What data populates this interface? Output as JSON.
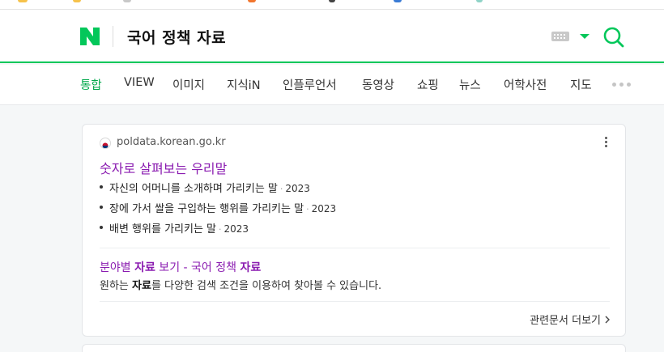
{
  "header": {
    "logo": "N",
    "query": "국어 정책 자료",
    "icons": [
      "keyboard-icon",
      "chevron-down-icon",
      "search-icon"
    ],
    "brand_color": "#03c75a"
  },
  "tabs": {
    "items": [
      {
        "label": "통합",
        "active": true
      },
      {
        "label": "VIEW"
      },
      {
        "label": "이미지"
      },
      {
        "label": "지식iN"
      },
      {
        "label": "인플루언서"
      },
      {
        "label": "동영상"
      },
      {
        "label": "쇼핑"
      },
      {
        "label": "뉴스"
      },
      {
        "label": "어학사전"
      },
      {
        "label": "지도"
      }
    ]
  },
  "result": {
    "source": "poldata.korean.go.kr",
    "title": "숫자로 살펴보는 우리말",
    "bullets": [
      {
        "text": "자신의 어머니를 소개하며 가리키는 말",
        "sep": "·",
        "year": "2023"
      },
      {
        "text": "장에 가서 쌀을 구입하는 행위를 가리키는 말",
        "sep": "·",
        "year": "2023"
      },
      {
        "text": "배변 행위를 가리키는 말",
        "sep": "·",
        "year": "2023"
      }
    ],
    "sub": {
      "title_pre": "분야별 ",
      "title_bold1": "자료",
      "title_mid": " 보기 - 국어 정책 ",
      "title_bold2": "자료",
      "desc_pre": "원하는 ",
      "desc_bold": "자료",
      "desc_post": "를 다양한 검색 조건을 이용하여 찾아볼 수 있습니다."
    },
    "more_label": "관련문서 더보기"
  }
}
